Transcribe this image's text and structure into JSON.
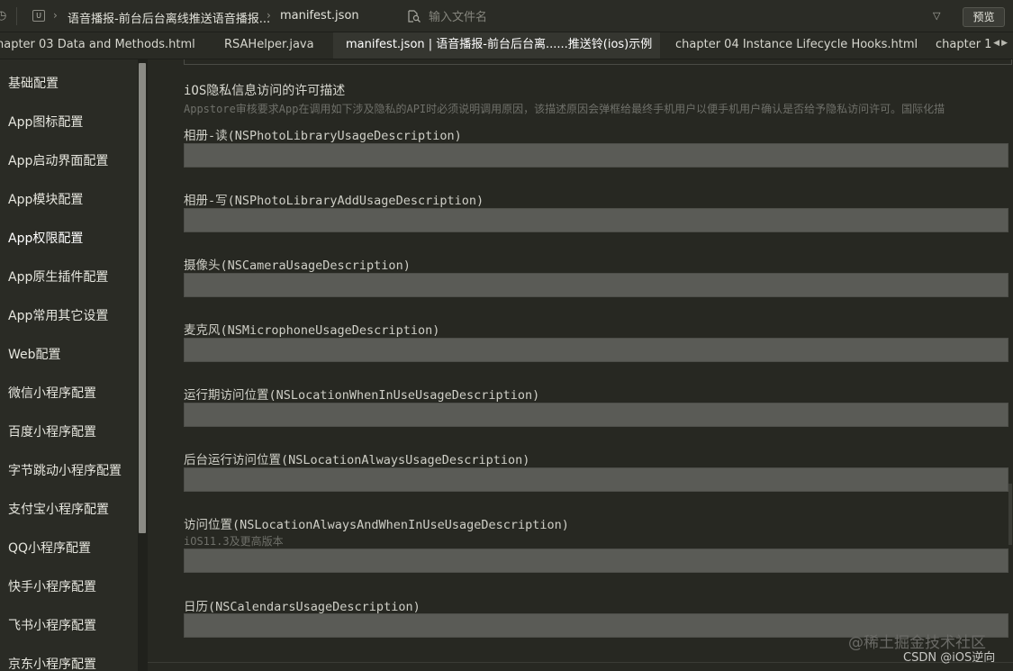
{
  "topbar": {
    "breadcrumb": [
      "语音播报-前台后台离线推送语音播报...",
      "manifest.json"
    ],
    "search": {
      "placeholder": "输入文件名",
      "value": ""
    },
    "preview_label": "预览"
  },
  "tabs": [
    {
      "label": "hapter 03 Data and Methods.html",
      "active": false
    },
    {
      "label": "RSAHelper.java",
      "active": false
    },
    {
      "label": "manifest.json | 语音播报-前台后台离......推送铃(ios)示例",
      "active": true
    },
    {
      "label": "chapter 04 Instance Lifecycle Hooks.html",
      "active": false
    },
    {
      "label": "chapter 1(",
      "active": false
    }
  ],
  "sidebar": {
    "active_index": 4,
    "items": [
      "基础配置",
      "App图标配置",
      "App启动界面配置",
      "App模块配置",
      "App权限配置",
      "App原生插件配置",
      "App常用其它设置",
      "Web配置",
      "微信小程序配置",
      "百度小程序配置",
      "字节跳动小程序配置",
      "支付宝小程序配置",
      "QQ小程序配置",
      "快手小程序配置",
      "飞书小程序配置",
      "京东小程序配置"
    ]
  },
  "section": {
    "title": "iOS隐私信息访问的许可描述",
    "description": "Appstore审核要求App在调用如下涉及隐私的API时必须说明调用原因，该描述原因会弹框给最终手机用户以便手机用户确认是否给予隐私访问许可。国际化描"
  },
  "fields": [
    {
      "label": "相册-读(NSPhotoLibraryUsageDescription)",
      "hint": "",
      "value": ""
    },
    {
      "label": "相册-写(NSPhotoLibraryAddUsageDescription)",
      "hint": "",
      "value": ""
    },
    {
      "label": "摄像头(NSCameraUsageDescription)",
      "hint": "",
      "value": ""
    },
    {
      "label": "麦克风(NSMicrophoneUsageDescription)",
      "hint": "",
      "value": ""
    },
    {
      "label": "运行期访问位置(NSLocationWhenInUseUsageDescription)",
      "hint": "",
      "value": ""
    },
    {
      "label": "后台运行访问位置(NSLocationAlwaysUsageDescription)",
      "hint": "",
      "value": ""
    },
    {
      "label": "访问位置(NSLocationAlwaysAndWhenInUseUsageDescription)",
      "hint": "iOS11.3及更高版本",
      "value": ""
    },
    {
      "label": "日历(NSCalendarsUsageDescription)",
      "hint": "",
      "value": ""
    }
  ],
  "watermark": {
    "line1": "@稀土掘金技术社区",
    "line2": "CSDN @iOS逆向"
  }
}
